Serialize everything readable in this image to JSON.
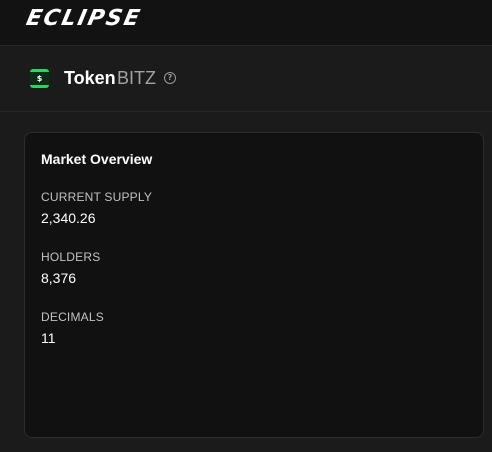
{
  "header": {
    "brand": "ECLIPSE"
  },
  "token": {
    "icon": "dollar-token-icon",
    "title": "Token",
    "symbol": "BITZ",
    "help_icon": "question-circle-icon"
  },
  "market_overview": {
    "title": "Market Overview",
    "stats": [
      {
        "label": "CURRENT SUPPLY",
        "value": "2,340.26"
      },
      {
        "label": "HOLDERS",
        "value": "8,376"
      },
      {
        "label": "DECIMALS",
        "value": "11"
      }
    ]
  },
  "colors": {
    "background": "#1b1b1b",
    "topbar": "#121212",
    "card": "#111111",
    "accent_green": "#2bd467"
  }
}
